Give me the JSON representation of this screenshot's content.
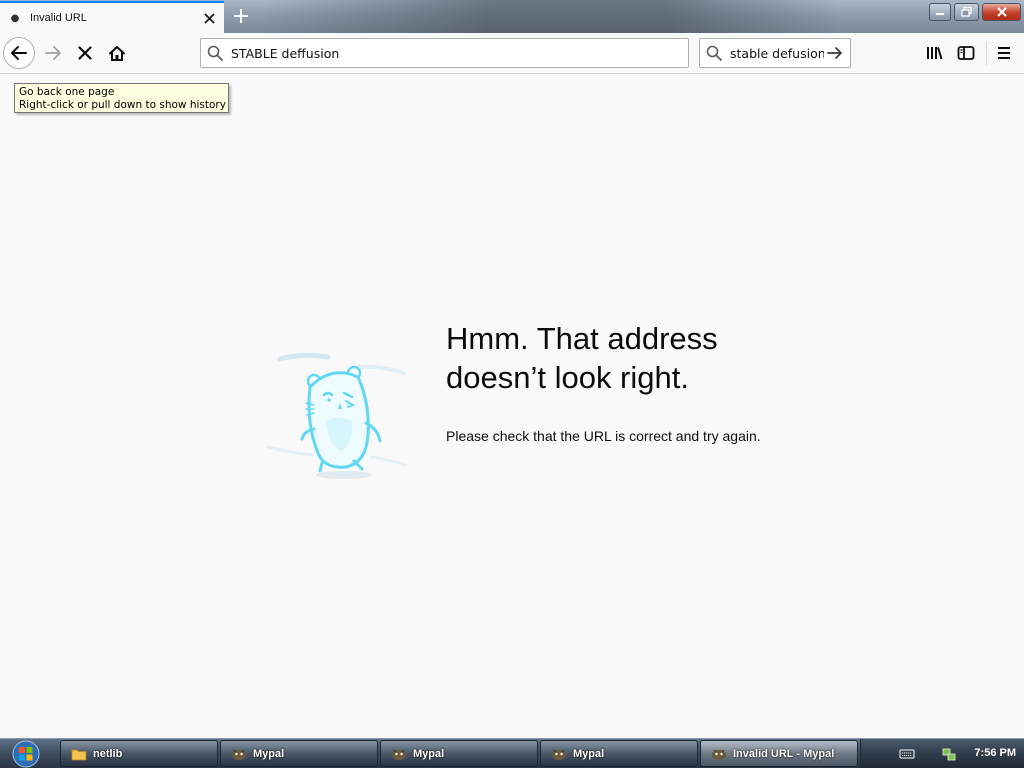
{
  "browser": {
    "tab": {
      "title": "Invalid URL",
      "loading_icon": "dot-icon",
      "close_icon": "close-icon"
    },
    "new_tab_icon": "plus-icon",
    "window_controls": [
      "minimize-icon",
      "maximize-icon",
      "close-icon"
    ]
  },
  "toolbar": {
    "url_value": "STABLE deffusion",
    "search_value": "stable defusion",
    "icons": [
      "back-arrow-icon",
      "forward-arrow-icon",
      "stop-icon",
      "home-icon",
      "search-icon",
      "go-arrow-icon",
      "library-icon",
      "sidebar-icon",
      "hamburger-menu-icon"
    ]
  },
  "tooltip": {
    "line1": "Go back one page",
    "line2": "Right-click or pull down to show history"
  },
  "error_page": {
    "title_line1": "Hmm. That address",
    "title_line2": "doesn’t look right.",
    "description": "Please check that the URL is correct and try again.",
    "illustration": "confused-hamster-icon"
  },
  "taskbar": {
    "items": [
      {
        "label": "netlib",
        "icon": "folder-icon",
        "active": false
      },
      {
        "label": "Mypal",
        "icon": "mypal-icon",
        "active": false
      },
      {
        "label": "Mypal",
        "icon": "mypal-icon",
        "active": false
      },
      {
        "label": "Mypal",
        "icon": "mypal-icon",
        "active": false
      },
      {
        "label": "Invalid URL - Mypal",
        "icon": "mypal-icon",
        "active": true
      }
    ],
    "clock": "7:56 PM",
    "tray_icons": [
      "keyboard-icon",
      "network-icon"
    ]
  },
  "colors": {
    "accent": "#0a84ff",
    "page_bg": "#f9f9fa",
    "illustration": "#61d8f3",
    "tooltip_bg": "#ffffe1"
  }
}
